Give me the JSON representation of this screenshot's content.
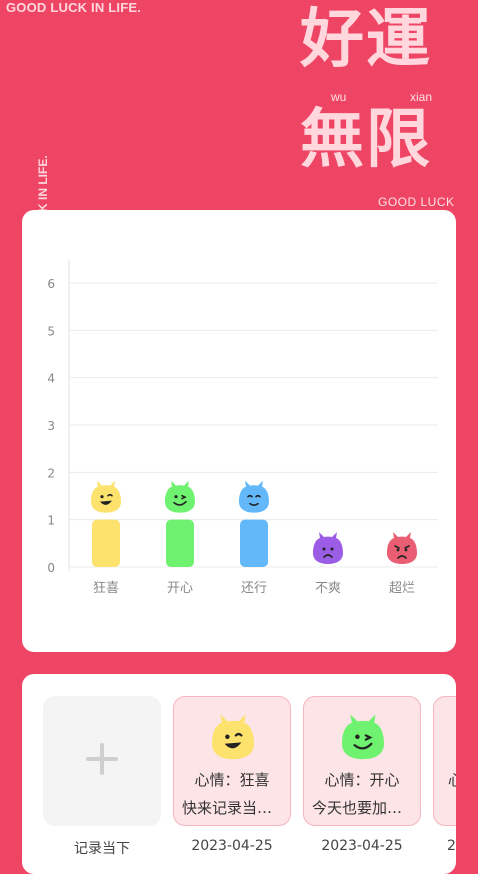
{
  "decor": {
    "top_left": "GOOD LUCK IN LIFE.",
    "side": "K IN LIFE.",
    "line1": "好運",
    "line2": "無限",
    "pinyin_left": "wu",
    "pinyin_right": "xian",
    "good_luck": "GOOD LUCK"
  },
  "colors": {
    "background": "#ef4565",
    "yellow": "#fde36e",
    "green": "#6ff26f",
    "blue": "#63b8f9",
    "purple": "#9b5de5",
    "red": "#ea5e73"
  },
  "chart_data": {
    "type": "bar",
    "categories": [
      "狂喜",
      "开心",
      "还行",
      "不爽",
      "超烂"
    ],
    "values": [
      1,
      1,
      1,
      0,
      0
    ],
    "y_ticks": [
      "0",
      "1",
      "2",
      "3",
      "4",
      "5",
      "6"
    ],
    "ylim": [
      0,
      6
    ],
    "grid": true,
    "bar_colors": [
      "#fde36e",
      "#6ff26f",
      "#63b8f9",
      "#9b5de5",
      "#ea5e73"
    ],
    "face_icons": [
      "ecstatic-face-icon",
      "happy-face-icon",
      "okay-face-icon",
      "upset-face-icon",
      "awful-face-icon"
    ]
  },
  "records": {
    "add_label": "记录当下",
    "items": [
      {
        "mood": "心情：狂喜",
        "note": "快来记录当下的心情吧",
        "date": "2023-04-25",
        "color": "#fde36e",
        "icon": "ecstatic-face-icon"
      },
      {
        "mood": "心情：开心",
        "note": "今天也要加油鸭",
        "date": "2023-04-25",
        "color": "#6ff26f",
        "icon": "happy-face-icon"
      },
      {
        "mood": "心",
        "note": "",
        "date": "2",
        "color": "#63b8f9",
        "icon": "okay-face-icon"
      }
    ]
  }
}
